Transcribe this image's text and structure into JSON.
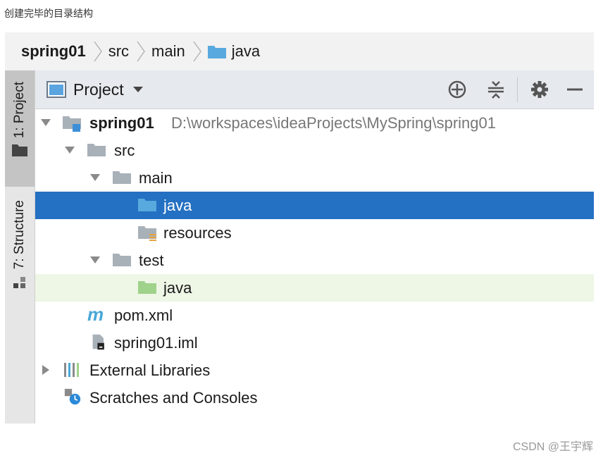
{
  "caption": "创建完毕的目录结构",
  "breadcrumb": {
    "items": [
      "spring01",
      "src",
      "main",
      "java"
    ]
  },
  "sidebar": {
    "tabs": [
      {
        "label": "1: Project",
        "active": true,
        "icon": "folder-icon"
      },
      {
        "label": "7: Structure",
        "active": false,
        "icon": "structure-icon"
      }
    ]
  },
  "panel": {
    "title": "Project",
    "icons": [
      "locate-icon",
      "collapse-all-icon",
      "gear-icon",
      "minimize-icon"
    ]
  },
  "tree": {
    "root": {
      "label": "spring01",
      "path": "D:\\workspaces\\ideaProjects\\MySpring\\spring01"
    },
    "src": "src",
    "main": "main",
    "main_java": "java",
    "resources": "resources",
    "test": "test",
    "test_java": "java",
    "pom": "pom.xml",
    "iml": "spring01.iml",
    "external": "External Libraries",
    "scratches": "Scratches and Consoles"
  },
  "colors": {
    "selection": "#2470c2",
    "test_highlight": "#eef6e6",
    "source_folder": "#58a9dd",
    "test_folder": "#9fd28a",
    "folder_gray": "#a8b0b8"
  },
  "watermark": "CSDN @王宇辉"
}
